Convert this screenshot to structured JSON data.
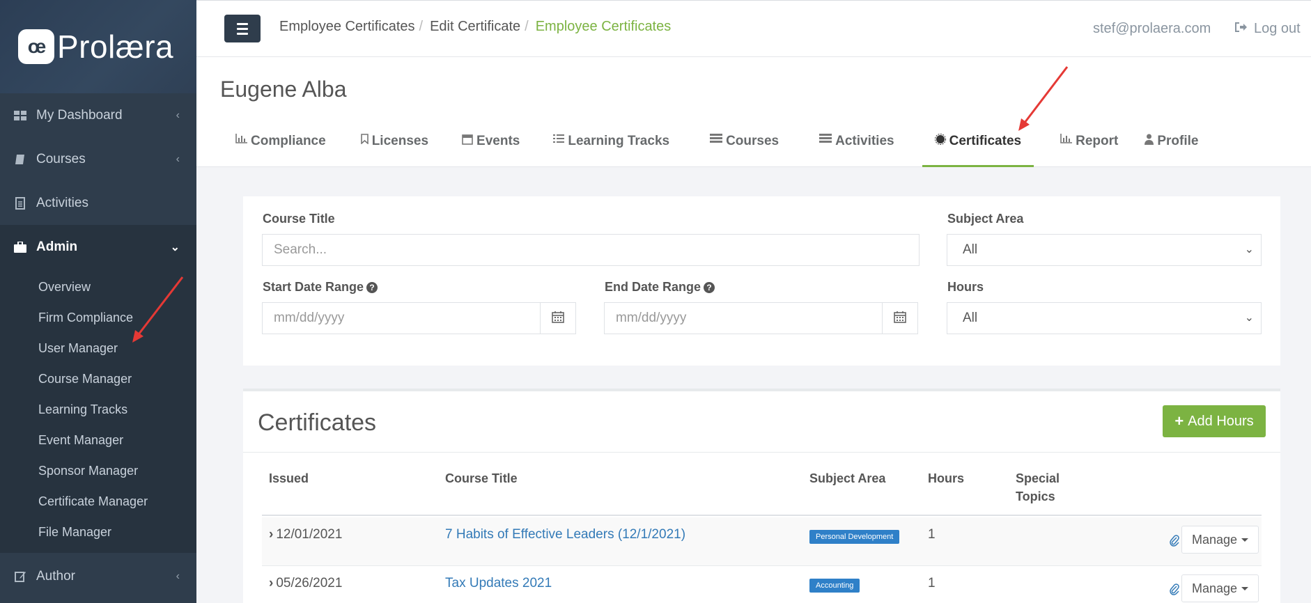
{
  "brand": {
    "mark": "œ",
    "name": "Prolæra"
  },
  "sidebar": {
    "items": [
      {
        "label": "My Dashboard",
        "icon": "dashboard-icon"
      },
      {
        "label": "Courses",
        "icon": "book-icon"
      },
      {
        "label": "Activities",
        "icon": "document-icon"
      },
      {
        "label": "Admin",
        "icon": "briefcase-icon"
      }
    ],
    "admin_subitems": [
      "Overview",
      "Firm Compliance",
      "User Manager",
      "Course Manager",
      "Learning Tracks",
      "Event Manager",
      "Sponsor Manager",
      "Certificate Manager",
      "File Manager"
    ],
    "author": {
      "label": "Author",
      "icon": "edit-icon"
    }
  },
  "topbar": {
    "breadcrumb": [
      "Employee Certificates",
      "Edit Certificate",
      "Employee Certificates"
    ],
    "user_email": "stef@prolaera.com",
    "logout_label": "Log out"
  },
  "person_name": "Eugene Alba",
  "tabs": [
    {
      "label": "Compliance",
      "icon": "bar-chart-icon"
    },
    {
      "label": "Licenses",
      "icon": "bookmark-icon"
    },
    {
      "label": "Events",
      "icon": "calendar-icon"
    },
    {
      "label": "Learning Tracks",
      "icon": "list-icon"
    },
    {
      "label": "Courses",
      "icon": "stack-icon"
    },
    {
      "label": "Activities",
      "icon": "stack-icon"
    },
    {
      "label": "Certificates",
      "icon": "certificate-icon",
      "active": true
    },
    {
      "label": "Report",
      "icon": "bar-chart-icon"
    },
    {
      "label": "Profile",
      "icon": "user-icon"
    }
  ],
  "filters": {
    "course_title_label": "Course Title",
    "course_title_placeholder": "Search...",
    "subject_area_label": "Subject Area",
    "subject_area_value": "All",
    "start_date_label": "Start Date Range",
    "start_date_placeholder": "mm/dd/yyyy",
    "end_date_label": "End Date Range",
    "end_date_placeholder": "mm/dd/yyyy",
    "hours_label": "Hours",
    "hours_value": "All"
  },
  "certificates": {
    "title": "Certificates",
    "add_button": "Add Hours",
    "columns": [
      "Issued",
      "Course Title",
      "Subject Area",
      "Hours",
      "Special Topics"
    ],
    "rows": [
      {
        "issued": "12/01/2021",
        "course_title": "7 Habits of Effective Leaders (12/1/2021)",
        "subject_area": "Personal Development",
        "hours": "1",
        "manage": "Manage"
      },
      {
        "issued": "05/26/2021",
        "course_title": "Tax Updates 2021",
        "subject_area": "Accounting",
        "hours": "1",
        "manage": "Manage"
      }
    ]
  },
  "colors": {
    "accent": "#7cb342",
    "sidebar": "#2f3d4c",
    "link": "#337ab7",
    "badge": "#2f80c8",
    "annotation_arrow": "#e53935"
  }
}
